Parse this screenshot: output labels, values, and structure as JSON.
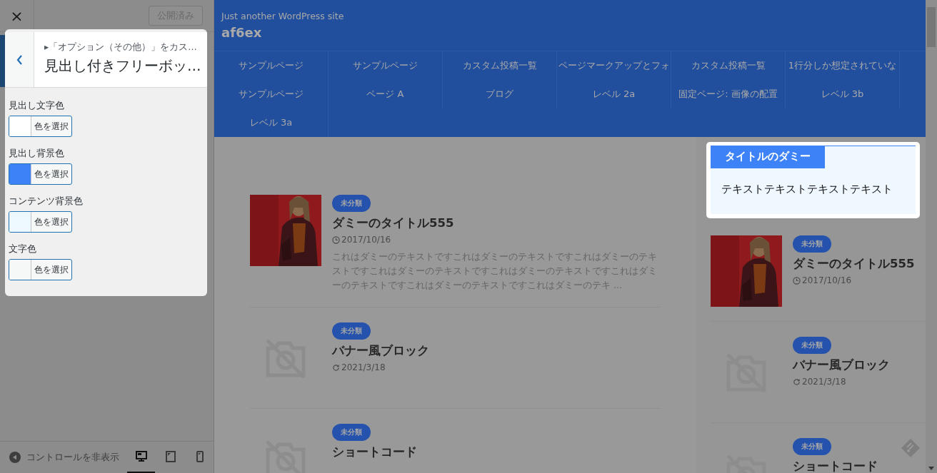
{
  "sidebar": {
    "close_label": "×",
    "publish_button": "公開済み",
    "panel": {
      "breadcrumb": "▸「オプション（その他）」をカス…",
      "title": "見出し付きフリーボッ…",
      "controls": [
        {
          "label": "見出し文字色",
          "button": "色を選択",
          "color": "#ffffff"
        },
        {
          "label": "見出し背景色",
          "button": "色を選択",
          "color": "#3d82f7"
        },
        {
          "label": "コンテンツ背景色",
          "button": "色を選択",
          "color": "#eef8ff"
        },
        {
          "label": "文字色",
          "button": "色を選択",
          "color": "#f6f7f7"
        }
      ]
    },
    "footer": {
      "hide_controls": "コントロールを非表示",
      "devices": [
        {
          "kind": "desktop",
          "selected": true
        },
        {
          "kind": "tablet",
          "selected": false
        },
        {
          "kind": "mobile",
          "selected": false
        }
      ]
    }
  },
  "preview": {
    "tagline": "Just another WordPress site",
    "site_title": "af6ex",
    "nav": [
      "サンプルページ",
      "サンプルページ",
      "カスタム投稿一覧",
      "ページマークアップとフォ",
      "カスタム投稿一覧",
      "1行分しか想定されていな",
      "サンプルページ",
      "ページ A",
      "ブログ",
      "レベル 2a",
      "固定ページ: 画像の配置",
      "レベル 3b",
      "レベル 3a"
    ],
    "posts": [
      {
        "category": "未分類",
        "title": "ダミーのタイトル555",
        "date": {
          "kind": "published",
          "text": "2017/10/16"
        },
        "excerpt": "これはダミーのテキストですこれはダミーのテキストですこれはダミーのテキストですこれはダミーのテキストですこれはダミーのテキストですこれはダミーのテキストですこれはダミーのテキストですこれはダミーのテキ ..."
      },
      {
        "kind": "placeholder",
        "category": "未分類",
        "title": "バナー風ブロック",
        "date": {
          "kind": "updated",
          "text": "2021/3/18"
        }
      },
      {
        "kind": "placeholder",
        "category": "未分類",
        "title": "ショートコード"
      }
    ],
    "widget": {
      "title": "タイトルのダミー",
      "body": "テキストテキストテキストテキスト"
    },
    "sidebar_posts": [
      {
        "category": "未分類",
        "title": "ダミーのタイトル555",
        "date": {
          "kind": "published",
          "text": "2017/10/16"
        }
      },
      {
        "kind": "placeholder",
        "category": "未分類",
        "title": "バナー風ブロック",
        "date": {
          "kind": "updated",
          "text": "2021/3/18"
        }
      },
      {
        "kind": "placeholder",
        "category": "未分類",
        "title": "ショートコード"
      }
    ]
  }
}
